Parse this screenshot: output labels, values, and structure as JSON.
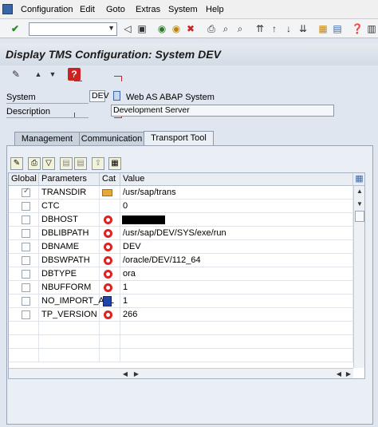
{
  "menu": {
    "items": [
      "Configuration",
      "Edit",
      "Goto",
      "Extras",
      "System",
      "Help"
    ]
  },
  "toolbar": {
    "command_field": ""
  },
  "header": {
    "title": "Display TMS Configuration: System DEV"
  },
  "form": {
    "system_label": "System",
    "system_value": "DEV",
    "system_type": "Web AS ABAP System",
    "description_label": "Description",
    "description_value": "Development Server"
  },
  "tabs": [
    {
      "label": "Management",
      "active": false
    },
    {
      "label": "Communication",
      "active": false
    },
    {
      "label": "Transport Tool",
      "active": true
    }
  ],
  "grid": {
    "columns": [
      "Global",
      "Parameters",
      "Cat",
      "Value"
    ],
    "rows": [
      {
        "global": true,
        "param": "TRANSDIR",
        "cat": "folder",
        "value": "/usr/sap/trans"
      },
      {
        "global": false,
        "param": "CTC",
        "cat": "",
        "value": "0"
      },
      {
        "global": false,
        "param": "DBHOST",
        "cat": "red",
        "value": ""
      },
      {
        "global": false,
        "param": "DBLIBPATH",
        "cat": "red",
        "value": "/usr/sap/DEV/SYS/exe/run"
      },
      {
        "global": false,
        "param": "DBNAME",
        "cat": "red",
        "value": "DEV"
      },
      {
        "global": false,
        "param": "DBSWPATH",
        "cat": "red",
        "value": "/oracle/DEV/112_64"
      },
      {
        "global": false,
        "param": "DBTYPE",
        "cat": "red",
        "value": "ora"
      },
      {
        "global": false,
        "param": "NBUFFORM",
        "cat": "red",
        "value": "1"
      },
      {
        "global": false,
        "param": "NO_IMPORT_ALL",
        "cat": "blue",
        "value": "1"
      },
      {
        "global": false,
        "param": "TP_VERSION",
        "cat": "red",
        "value": "266"
      }
    ]
  },
  "colors": {
    "accent": "#3a66a8",
    "status_red": "#dd2222",
    "background": "#dfe6ef"
  }
}
